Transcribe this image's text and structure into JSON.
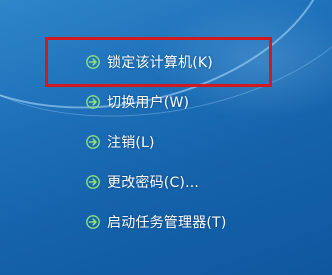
{
  "menu": {
    "items": [
      {
        "label": "锁定该计算机(K)",
        "icon": "arrow-right-icon"
      },
      {
        "label": "切换用户(W)",
        "icon": "arrow-right-icon"
      },
      {
        "label": "注销(L)",
        "icon": "arrow-right-icon"
      },
      {
        "label": "更改密码(C)...",
        "icon": "arrow-right-icon"
      },
      {
        "label": "启动任务管理器(T)",
        "icon": "arrow-right-icon"
      }
    ]
  },
  "colors": {
    "background": "#1d6fb8",
    "text": "#ffffff",
    "highlight_border": "#d2191e",
    "arrow": "#8fe07a"
  }
}
